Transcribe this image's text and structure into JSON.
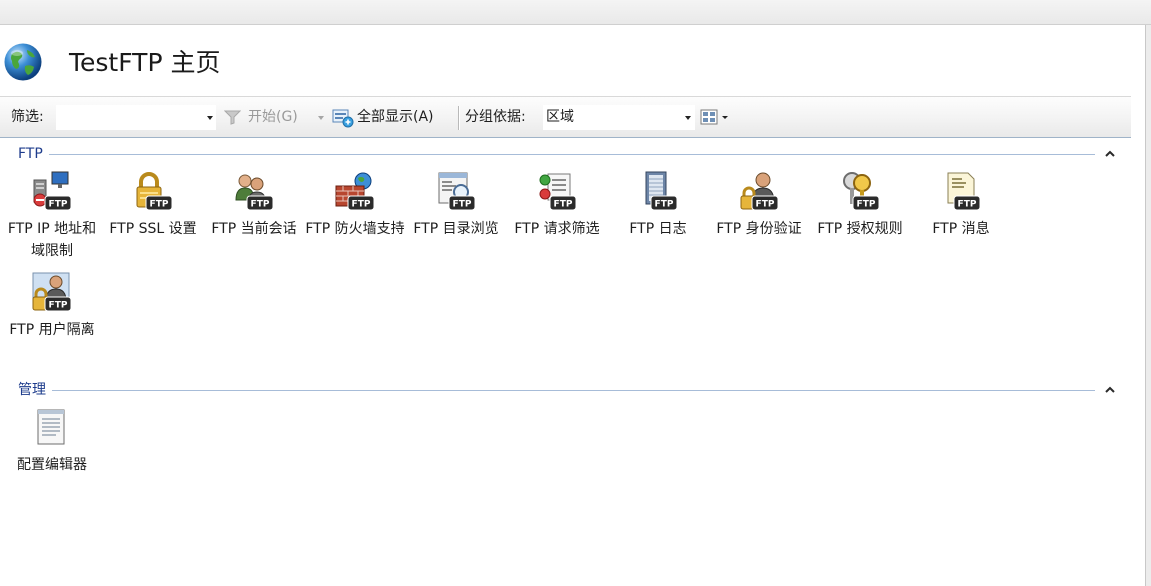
{
  "header": {
    "title": "TestFTP 主页"
  },
  "toolbar": {
    "filter_label": "筛选:",
    "filter_value": "",
    "start_label": "开始(G)",
    "show_all_label": "全部显示(A)",
    "group_by_label": "分组依据:",
    "group_by_value": "区域"
  },
  "groups": [
    {
      "title": "FTP",
      "collapsed": false,
      "items": [
        {
          "icon": "ftp-ip-restrictions-icon",
          "label": "FTP IP 地址和域限制"
        },
        {
          "icon": "ftp-ssl-icon",
          "label": "FTP SSL 设置"
        },
        {
          "icon": "ftp-current-sessions-icon",
          "label": "FTP 当前会话"
        },
        {
          "icon": "ftp-firewall-icon",
          "label": "FTP 防火墙支持"
        },
        {
          "icon": "ftp-directory-browsing-icon",
          "label": "FTP 目录浏览"
        },
        {
          "icon": "ftp-request-filtering-icon",
          "label": "FTP 请求筛选"
        },
        {
          "icon": "ftp-logging-icon",
          "label": "FTP 日志"
        },
        {
          "icon": "ftp-authentication-icon",
          "label": "FTP 身份验证"
        },
        {
          "icon": "ftp-authorization-rules-icon",
          "label": "FTP 授权规则"
        },
        {
          "icon": "ftp-messages-icon",
          "label": "FTP 消息"
        },
        {
          "icon": "ftp-user-isolation-icon",
          "label": "FTP 用户隔离"
        }
      ]
    },
    {
      "title": "管理",
      "collapsed": false,
      "items": [
        {
          "icon": "configuration-editor-icon",
          "label": "配置编辑器"
        }
      ]
    }
  ],
  "colors": {
    "group_title": "#1e3c8c",
    "group_line": "#a7bcd8",
    "ftp_badge": "#2b2b2b"
  }
}
